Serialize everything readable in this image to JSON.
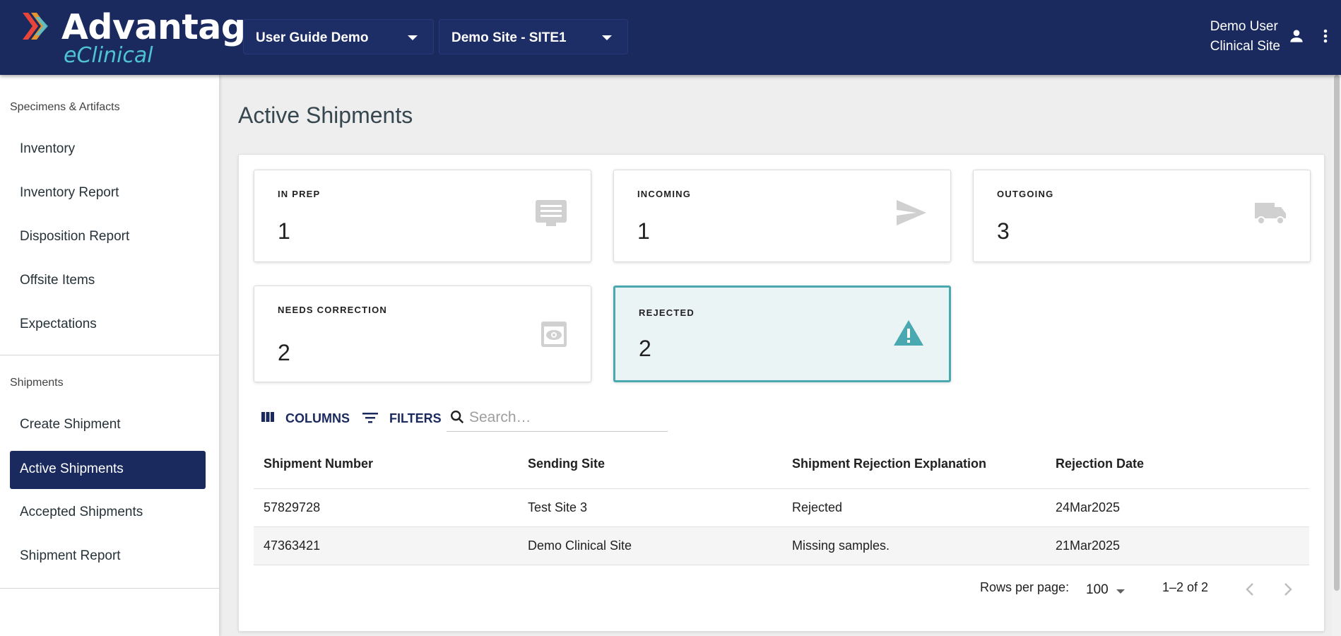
{
  "header": {
    "logo_name": "Advantage",
    "logo_sub": "eClinical",
    "study_select": "User Guide Demo",
    "site_select": "Demo Site - SITE1",
    "user_name": "Demo User",
    "user_role": "Clinical Site",
    "icons": [
      "person-icon",
      "more-vert-icon"
    ],
    "colors": {
      "bar": "#1a2a5e",
      "accent": "#4fc3d2"
    }
  },
  "sidebar": {
    "section1_title": "Specimens & Artifacts",
    "section1_items": [
      "Inventory",
      "Inventory Report",
      "Disposition Report",
      "Offsite Items",
      "Expectations"
    ],
    "section2_title": "Shipments",
    "section2_items": [
      "Create Shipment",
      "Active Shipments",
      "Accepted Shipments",
      "Shipment Report"
    ],
    "active_item": "Active Shipments"
  },
  "main": {
    "page_title": "Active Shipments",
    "stats": [
      {
        "label": "IN PREP",
        "value": "1",
        "icon": "list-icon"
      },
      {
        "label": "INCOMING",
        "value": "1",
        "icon": "send-icon"
      },
      {
        "label": "OUTGOING",
        "value": "3",
        "icon": "truck-icon"
      },
      {
        "label": "NEEDS CORRECTION",
        "value": "2",
        "icon": "preview-icon"
      },
      {
        "label": "REJECTED",
        "value": "2",
        "icon": "warning-icon"
      }
    ],
    "selected_stat": "REJECTED",
    "toolbar": {
      "columns_label": "COLUMNS",
      "filters_label": "FILTERS",
      "search_placeholder": "Search…"
    },
    "table": {
      "headers": [
        "Shipment Number",
        "Sending Site",
        "Shipment Rejection Explanation",
        "Rejection Date"
      ],
      "rows": [
        [
          "57829728",
          "Test Site 3",
          "Rejected",
          "24Mar2025"
        ],
        [
          "47363421",
          "Demo Clinical Site",
          "Missing samples.",
          "21Mar2025"
        ]
      ]
    },
    "pagination": {
      "rows_per_page_label": "Rows per page:",
      "rows_per_page_value": "100",
      "range": "1–2 of 2"
    }
  }
}
